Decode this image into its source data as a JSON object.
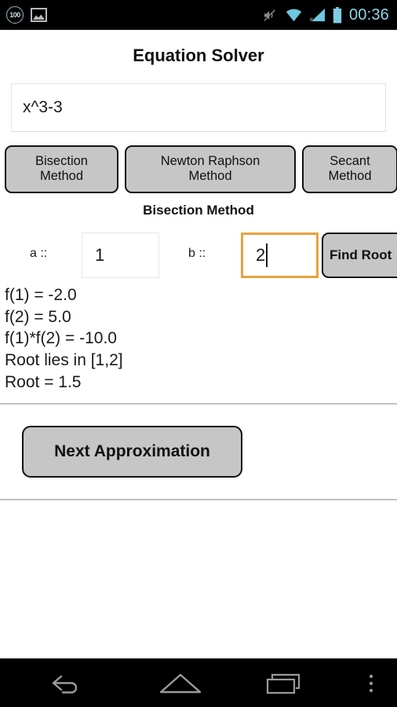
{
  "status_bar": {
    "battery_badge": "100",
    "icons": [
      "battery-100-badge",
      "gallery-icon",
      "mute-icon",
      "wifi-icon",
      "signal-icon",
      "battery-icon"
    ],
    "time": "00:36",
    "accent_color": "#8fd5e8"
  },
  "app": {
    "title": "Equation Solver",
    "equation_input": {
      "value": "x^3-3",
      "placeholder": "Enter equation"
    },
    "methods": [
      {
        "label": "Bisection\nMethod",
        "selected": true
      },
      {
        "label": "Newton Raphson\nMethod",
        "selected": false
      },
      {
        "label": "Secant\nMethod",
        "selected": false
      }
    ],
    "section_title": "Bisection Method",
    "bounds": {
      "a_label": "a ::",
      "a_value": "1",
      "a_placeholder": "a",
      "b_label": "b ::",
      "b_value": "2",
      "b_placeholder": "b",
      "b_focused": true,
      "focus_color": "#e8a33d"
    },
    "find_root_label": "Find Root",
    "results": [
      "f(1) = -2.0",
      "f(2) = 5.0",
      "f(1)*f(2) = -10.0",
      "Root lies in [1,2]",
      "Root = 1.5"
    ],
    "next_approximation_label": "Next Approximation",
    "button_fill": "#c6c6c6"
  },
  "nav_bar": {
    "back": "back-icon",
    "home": "home-icon",
    "recents": "recents-icon",
    "menu": "overflow-menu-icon"
  }
}
